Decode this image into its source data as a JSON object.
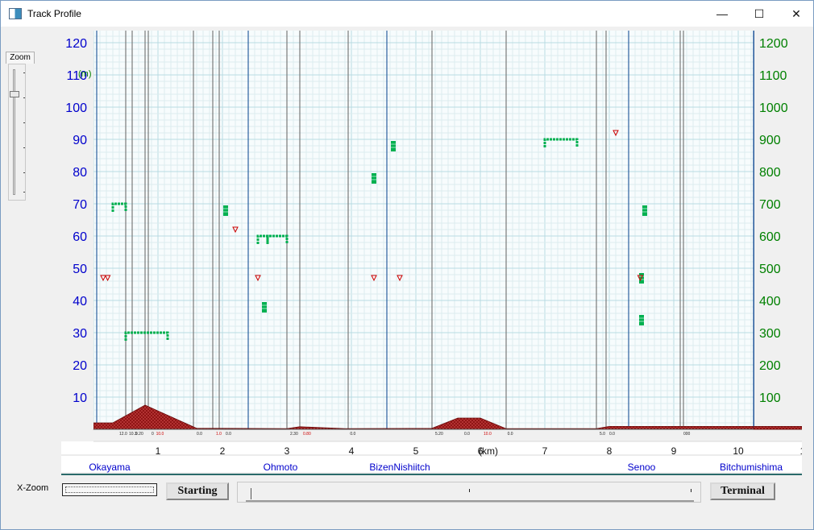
{
  "window": {
    "title": "Track Profile",
    "min": "—",
    "max": "☐",
    "close": "✕"
  },
  "zoom": {
    "label": "Zoom"
  },
  "xzoom": {
    "label": "X-Zoom"
  },
  "buttons": {
    "starting": "Starting",
    "terminal": "Terminal"
  },
  "chart_data": {
    "type": "profile",
    "left_axis": {
      "ticks": [
        "10",
        "20",
        "30",
        "40",
        "50",
        "60",
        "70",
        "80",
        "90",
        "100",
        "110",
        "120"
      ],
      "unit": "(m)",
      "range": [
        0,
        120
      ],
      "color": "#0000cc"
    },
    "right_axis": {
      "ticks": [
        "100",
        "200",
        "300",
        "400",
        "500",
        "600",
        "700",
        "800",
        "900",
        "1000",
        "1100",
        "1200"
      ],
      "range": [
        0,
        1200
      ],
      "color": "#008000"
    },
    "x_axis": {
      "ticks": [
        "1",
        "2",
        "3",
        "4",
        "5",
        "6",
        "7",
        "8",
        "9",
        "10",
        "1"
      ],
      "unit": "(km)",
      "range": [
        0,
        11
      ]
    },
    "stations": [
      {
        "name": "Okayama",
        "km": 0.25
      },
      {
        "name": "Ohmoto",
        "km": 2.9
      },
      {
        "name": "BizenNishiitch",
        "km": 4.75
      },
      {
        "name": "Senoo",
        "km": 8.5
      },
      {
        "name": "Bitchumishima",
        "km": 10.2
      }
    ],
    "grade_labels": [
      {
        "km": 0.4,
        "text": "12.0",
        "color": "black"
      },
      {
        "km": 0.55,
        "text": "10.3",
        "color": "black"
      },
      {
        "km": 0.65,
        "text": "0.20",
        "color": "black"
      },
      {
        "km": 0.9,
        "text": "0",
        "color": "black"
      },
      {
        "km": 0.97,
        "text": "10.0",
        "color": "red"
      },
      {
        "km": 1.6,
        "text": "0.0",
        "color": "black"
      },
      {
        "km": 1.9,
        "text": "1.0",
        "color": "red"
      },
      {
        "km": 2.05,
        "text": "0.0",
        "color": "black"
      },
      {
        "km": 3.05,
        "text": "2.30",
        "color": "black"
      },
      {
        "km": 3.25,
        "text": "0.80",
        "color": "red"
      },
      {
        "km": 3.98,
        "text": "0.0",
        "color": "black"
      },
      {
        "km": 5.3,
        "text": "5.20",
        "color": "black"
      },
      {
        "km": 5.75,
        "text": "0.0",
        "color": "black"
      },
      {
        "km": 6.05,
        "text": "10.0",
        "color": "red"
      },
      {
        "km": 6.42,
        "text": "0.0",
        "color": "black"
      },
      {
        "km": 7.85,
        "text": "5.0",
        "color": "black"
      },
      {
        "km": 8.0,
        "text": "0.0",
        "color": "black"
      },
      {
        "km": 9.15,
        "text": "000",
        "color": "black"
      }
    ],
    "profile": [
      [
        0,
        2
      ],
      [
        0.3,
        2
      ],
      [
        0.8,
        7.5
      ],
      [
        1.6,
        0.3
      ],
      [
        2.0,
        0.3
      ],
      [
        3.0,
        0.2
      ],
      [
        3.2,
        0.8
      ],
      [
        3.9,
        0.2
      ],
      [
        5.25,
        0.3
      ],
      [
        5.65,
        3.5
      ],
      [
        6.0,
        3.5
      ],
      [
        6.4,
        0.2
      ],
      [
        7.8,
        0.2
      ],
      [
        8.0,
        0.9
      ],
      [
        11,
        0.9
      ]
    ],
    "vertical_lines_gray": [
      0.5,
      0.6,
      0.8,
      0.85,
      1.55,
      1.85,
      1.95,
      3.0,
      3.2,
      3.95,
      5.25,
      6.4,
      7.8,
      7.95,
      9.1,
      9.15
    ],
    "vertical_lines_blue": [
      0.05,
      2.4,
      4.55,
      8.3,
      10.25
    ],
    "bridges": [
      {
        "kind": "arc",
        "from": 0.3,
        "to": 0.5,
        "alt": 700
      },
      {
        "kind": "arc",
        "from": 0.5,
        "to": 1.15,
        "alt": 300
      },
      {
        "kind": "arc",
        "from": 2.55,
        "to": 2.7,
        "alt": 600
      },
      {
        "kind": "arc",
        "from": 2.7,
        "to": 3.0,
        "alt": 600
      },
      {
        "kind": "arc",
        "from": 7.0,
        "to": 7.5,
        "alt": 900
      },
      {
        "kind": "block",
        "km": 2.05,
        "alt": 680
      },
      {
        "kind": "block",
        "km": 2.65,
        "alt": 380
      },
      {
        "kind": "block",
        "km": 4.35,
        "alt": 780
      },
      {
        "kind": "block",
        "km": 4.65,
        "alt": 880
      },
      {
        "kind": "block",
        "km": 8.55,
        "alt": 680
      },
      {
        "kind": "block",
        "km": 8.5,
        "alt": 470
      },
      {
        "kind": "block",
        "km": 8.5,
        "alt": 340
      }
    ],
    "markers": [
      {
        "km": 0.15,
        "alt": 470
      },
      {
        "km": 0.22,
        "alt": 470
      },
      {
        "km": 2.2,
        "alt": 620
      },
      {
        "km": 2.55,
        "alt": 470
      },
      {
        "km": 4.35,
        "alt": 470
      },
      {
        "km": 4.75,
        "alt": 470
      },
      {
        "km": 8.1,
        "alt": 920
      },
      {
        "km": 8.48,
        "alt": 470
      }
    ]
  }
}
